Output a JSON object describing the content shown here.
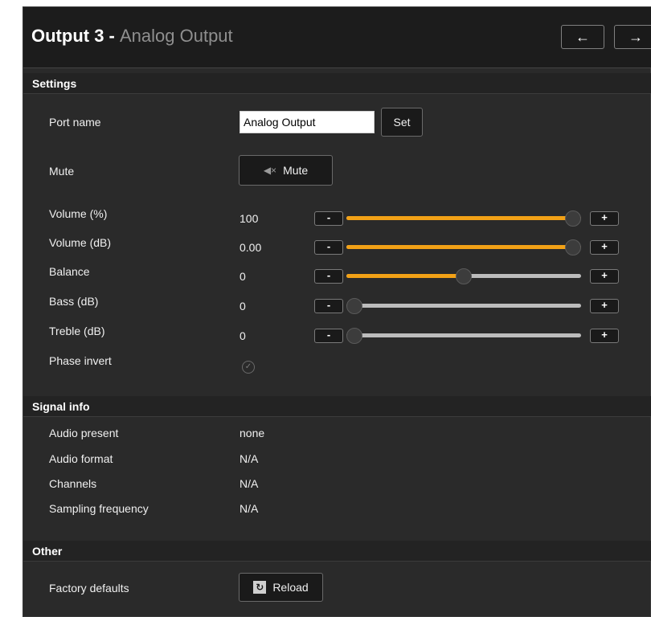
{
  "header": {
    "title_main": "Output 3",
    "title_sep": " - ",
    "title_sub": "Analog Output",
    "prev_icon": "arrow-left-icon",
    "next_icon": "arrow-right-icon"
  },
  "sections": {
    "settings": "Settings",
    "signal_info": "Signal info",
    "other": "Other"
  },
  "settings": {
    "port_name_label": "Port name",
    "port_name_value": "Analog Output",
    "set_label": "Set",
    "mute_label": "Mute",
    "mute_button_label": "Mute",
    "mute_icon": "speaker-muted-icon",
    "phase_invert_label": "Phase invert",
    "phase_invert_icon": "check-circle-icon",
    "sliders": [
      {
        "label": "Volume (%)",
        "value": "100",
        "fraction": 1.0
      },
      {
        "label": "Volume (dB)",
        "value": "0.00",
        "fraction": 1.0
      },
      {
        "label": "Balance",
        "value": "0",
        "fraction": 0.5
      },
      {
        "label": "Bass (dB)",
        "value": "0",
        "fraction": 0.0
      },
      {
        "label": "Treble (dB)",
        "value": "0",
        "fraction": 0.0
      }
    ],
    "minus_label": "-",
    "plus_label": "+"
  },
  "signal_info": {
    "rows": [
      {
        "label": "Audio present",
        "value": "none"
      },
      {
        "label": "Audio format",
        "value": "N/A"
      },
      {
        "label": "Channels",
        "value": "N/A"
      },
      {
        "label": "Sampling frequency",
        "value": "N/A"
      }
    ]
  },
  "other": {
    "factory_defaults_label": "Factory defaults",
    "reload_label": "Reload",
    "reload_icon": "reload-icon"
  },
  "colors": {
    "accent": "#f2a116",
    "panel_bg": "#2a2a2a",
    "header_bg": "#1c1c1c"
  }
}
